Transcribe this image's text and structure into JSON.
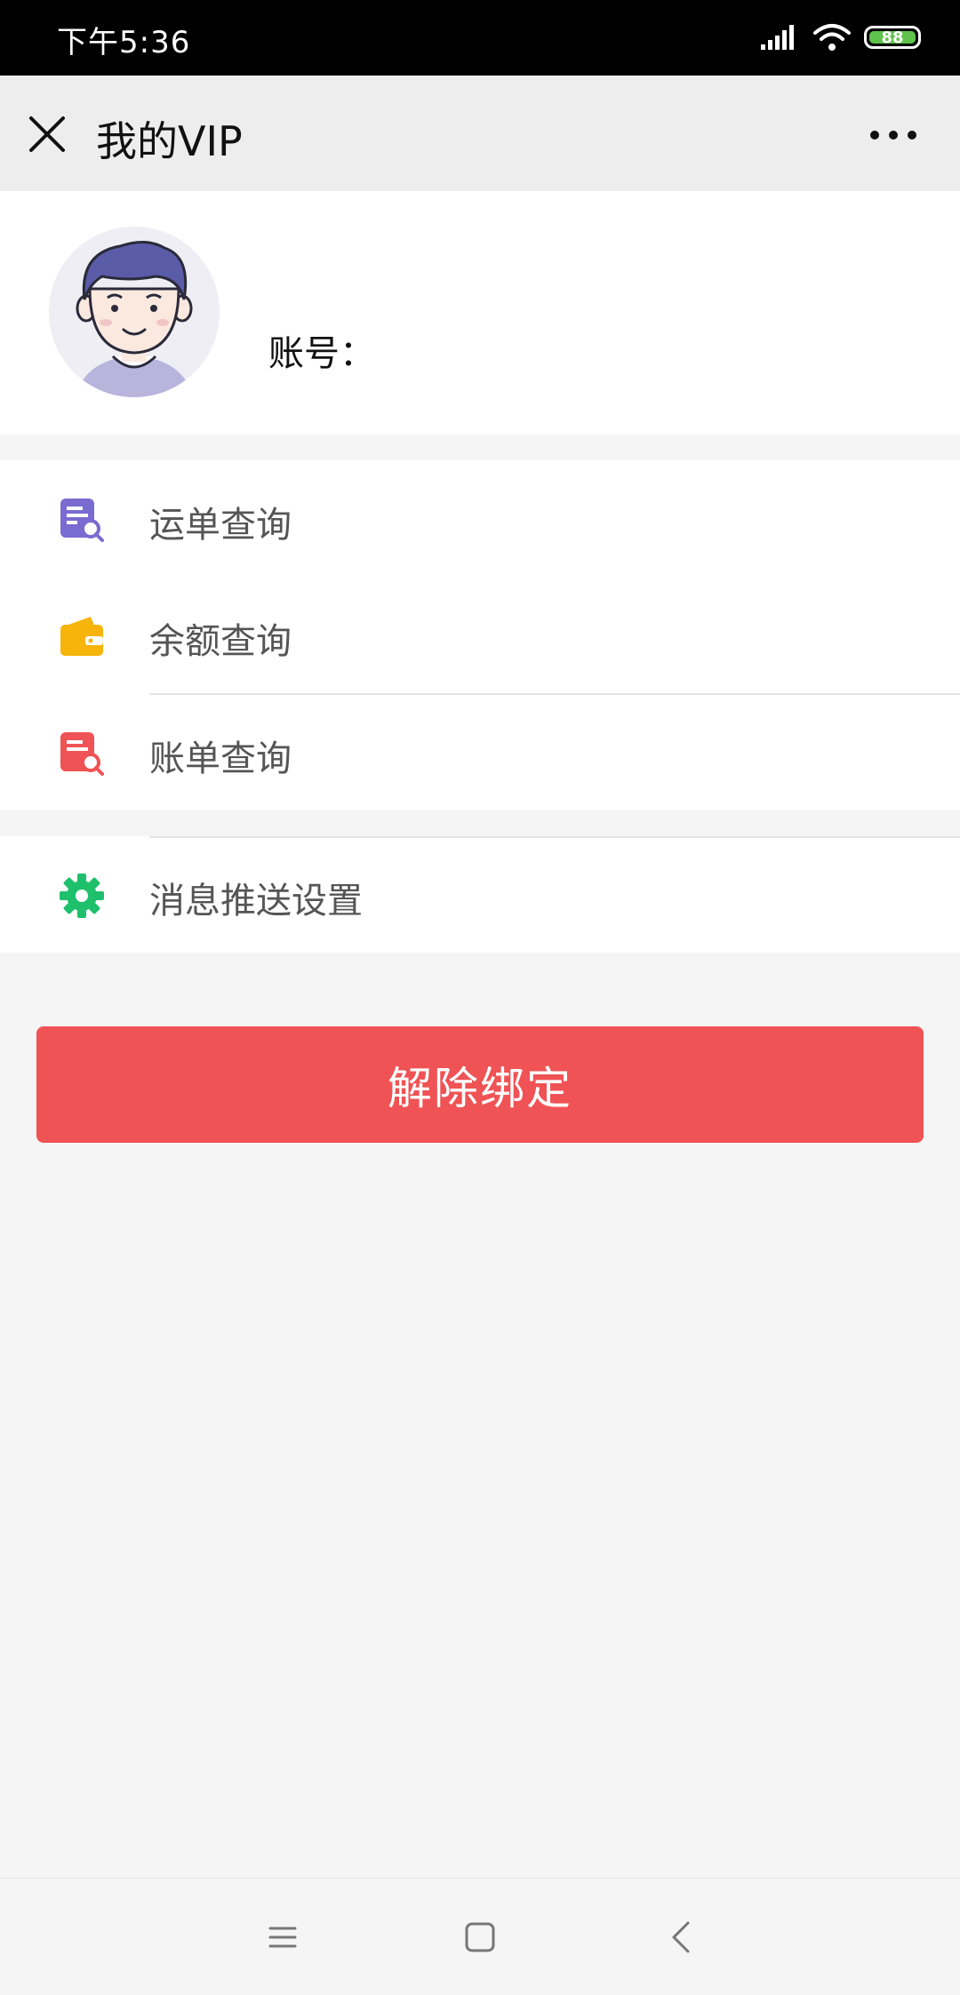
{
  "status_bar": {
    "time": "下午5:36",
    "battery_level": "88",
    "icons": [
      "signal-icon",
      "wifi-icon",
      "battery-icon"
    ]
  },
  "title_bar": {
    "title": "我的VIP",
    "close_icon": "close-icon",
    "more_icon": "more-icon"
  },
  "profile": {
    "account_label": "账号："
  },
  "menu": {
    "items": [
      {
        "label": "运单查询",
        "icon": "waybill-search-icon",
        "color": "#7a6bd0"
      },
      {
        "label": "余额查询",
        "icon": "wallet-icon",
        "color": "#f7b40a"
      },
      {
        "label": "账单查询",
        "icon": "bill-search-icon",
        "color": "#ef5355"
      }
    ],
    "settings": {
      "label": "消息推送设置",
      "icon": "gear-icon",
      "color": "#1fc06b"
    }
  },
  "unbind_button": {
    "label": "解除绑定",
    "color": "#ef5355"
  },
  "nav_bar": {
    "icons": [
      "menu-icon",
      "home-icon",
      "back-icon"
    ]
  }
}
